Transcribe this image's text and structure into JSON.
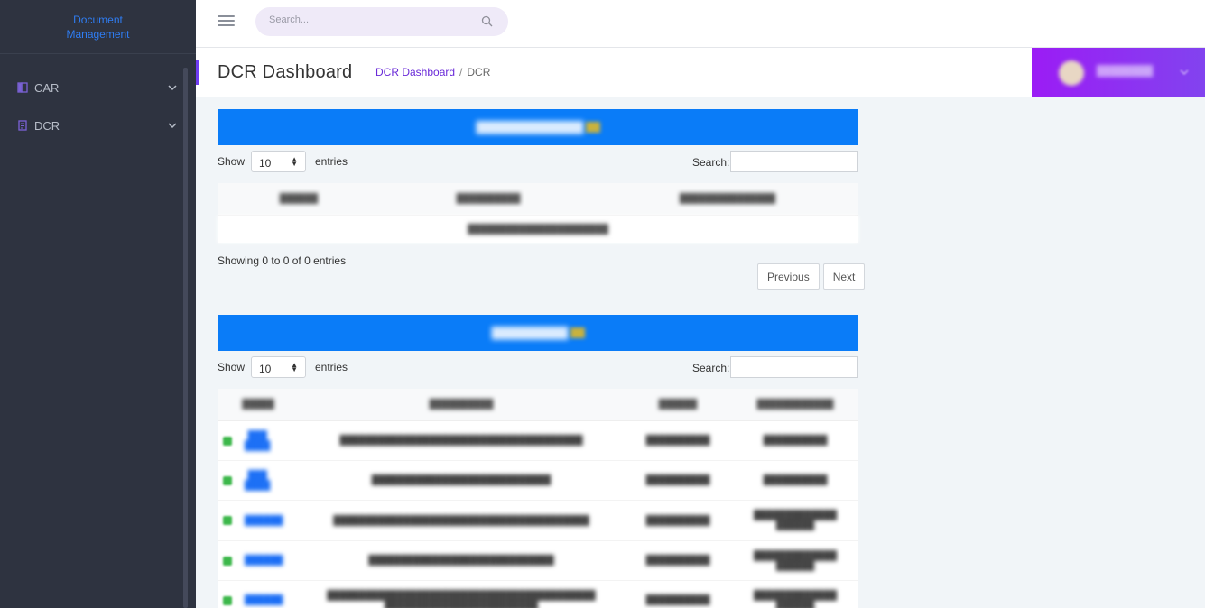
{
  "app": {
    "brand": "Document Management"
  },
  "sidebar": {
    "items": [
      {
        "label": "CAR",
        "icon": "book-icon"
      },
      {
        "label": "DCR",
        "icon": "document-icon"
      }
    ]
  },
  "topbar": {
    "search_placeholder": "Search..."
  },
  "header": {
    "title": "DCR Dashboard",
    "breadcrumb": {
      "link": "DCR Dashboard",
      "separator": "/",
      "current": "DCR"
    }
  },
  "colors": {
    "accent": "#6f3cf2",
    "panel_header": "#0a7cf8",
    "sidebar_bg": "#2e3340",
    "brand": "#2f7df3",
    "status_green": "#3cb74a"
  },
  "panel1": {
    "length_label": "Show",
    "length_value": "10",
    "entries_label": "entries",
    "search_label": "Search:",
    "info": "Showing 0 to 0 of 0 entries",
    "prev": "Previous",
    "next": "Next"
  },
  "panel2": {
    "length_label": "Show",
    "length_value": "10",
    "entries_label": "entries",
    "search_label": "Search:"
  }
}
